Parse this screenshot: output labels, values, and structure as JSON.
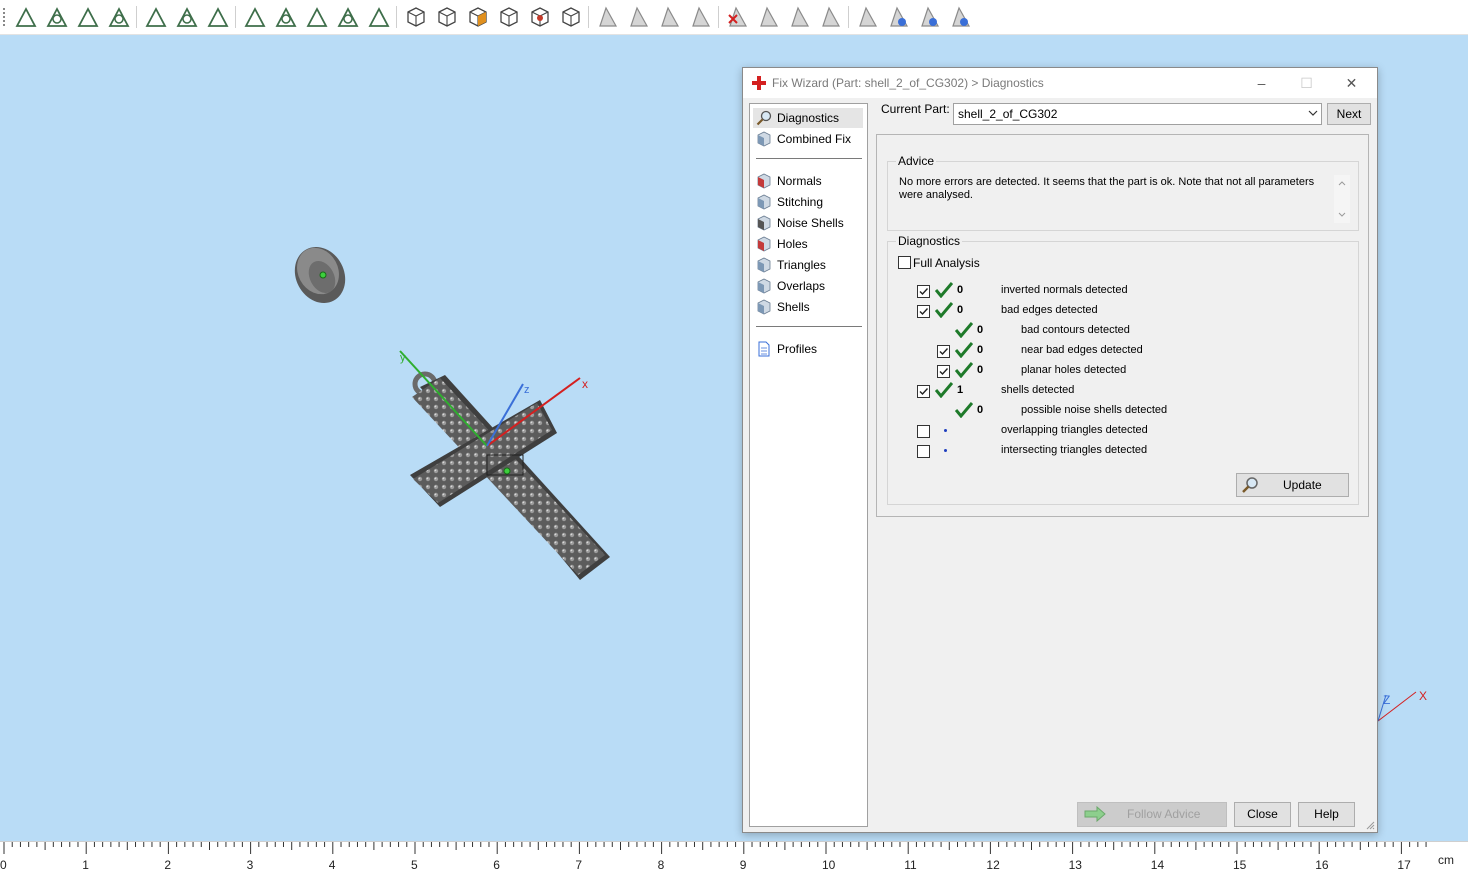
{
  "toolbar": {
    "groups": [
      [
        "arrow-select-icon",
        "face-select-icon",
        "surface-select-icon",
        "shell-select-icon"
      ],
      [
        "box-select-icon",
        "lasso-select-icon",
        "brush-select-icon"
      ],
      [
        "mesh-select-icon",
        "node-select-icon",
        "cut-select-icon",
        "wheel-select-icon",
        "sphere-select-icon"
      ],
      [
        "view-front-icon",
        "view-top-icon",
        "view-iso-icon",
        "view-wire-icon",
        "view-shaded-icon",
        "view-all-icon"
      ],
      [
        "triangle-mark-icon",
        "triangle-unmark-icon",
        "triangle-expand-icon",
        "triangle-shrink-icon"
      ],
      [
        "delete-triangles-icon",
        "invert-triangles-icon",
        "cut-triangles-icon",
        "split-triangles-icon"
      ],
      [
        "measure-icon",
        "measure-distance-icon",
        "measure-angle-icon",
        "measure-reset-icon"
      ]
    ]
  },
  "viewport": {
    "background": "#b9dcf6",
    "axis_labels": {
      "x": "x",
      "y": "y",
      "z": "z"
    },
    "corner_axis_labels": {
      "x": "X",
      "z": "Z"
    },
    "axis_colors": {
      "x": "#d42020",
      "y": "#2fae2f",
      "z": "#3a6fd8"
    }
  },
  "ruler": {
    "ticks": [
      "0",
      "1",
      "2",
      "3",
      "4",
      "5",
      "6",
      "7",
      "8",
      "9",
      "10",
      "11",
      "12",
      "13",
      "14",
      "15",
      "16",
      "17"
    ],
    "unit": "cm"
  },
  "dialog": {
    "title": "Fix Wizard (Part: shell_2_of_CG302) > Diagnostics",
    "title_icon": "red-cross-icon",
    "window_buttons": {
      "minimize": "–",
      "maximize": "☐",
      "close": "✕"
    },
    "nav": {
      "items": [
        {
          "label": "Diagnostics",
          "icon": "magnifier-icon",
          "selected": true
        },
        {
          "label": "Combined Fix",
          "icon": "combined-fix-icon"
        },
        {
          "label": "Normals",
          "icon": "normals-icon"
        },
        {
          "label": "Stitching",
          "icon": "stitching-icon"
        },
        {
          "label": "Noise Shells",
          "icon": "noise-shells-icon"
        },
        {
          "label": "Holes",
          "icon": "holes-icon"
        },
        {
          "label": "Triangles",
          "icon": "triangles-icon"
        },
        {
          "label": "Overlaps",
          "icon": "overlaps-icon"
        },
        {
          "label": "Shells",
          "icon": "shells-icon"
        },
        {
          "label": "Profiles",
          "icon": "profiles-icon"
        }
      ]
    },
    "current_part_label": "Current Part:",
    "current_part_value": "shell_2_of_CG302",
    "next_button": "Next",
    "advice": {
      "title": "Advice",
      "text": "No more errors are detected. It seems that the part is ok. Note that not all parameters were analysed."
    },
    "diagnostics": {
      "title": "Diagnostics",
      "full_analysis_label": "Full Analysis",
      "full_analysis_checked": false,
      "rows": [
        {
          "checkbox": true,
          "checked": true,
          "status": "ok",
          "count": "0",
          "label": "inverted normals detected",
          "indent": 0
        },
        {
          "checkbox": true,
          "checked": true,
          "status": "ok",
          "count": "0",
          "label": "bad edges detected",
          "indent": 0
        },
        {
          "checkbox": false,
          "checked": false,
          "status": "ok",
          "count": "0",
          "label": "bad contours detected",
          "indent": 1
        },
        {
          "checkbox": true,
          "checked": true,
          "status": "ok",
          "count": "0",
          "label": "near bad edges detected",
          "indent": 1
        },
        {
          "checkbox": true,
          "checked": true,
          "status": "ok",
          "count": "0",
          "label": "planar holes detected",
          "indent": 1
        },
        {
          "checkbox": true,
          "checked": true,
          "status": "ok",
          "count": "1",
          "label": "shells detected",
          "indent": 0
        },
        {
          "checkbox": false,
          "checked": false,
          "status": "ok",
          "count": "0",
          "label": "possible noise shells detected",
          "indent": 1
        },
        {
          "checkbox": true,
          "checked": false,
          "status": "pending",
          "count": "",
          "label": "overlapping triangles detected",
          "indent": 0
        },
        {
          "checkbox": true,
          "checked": false,
          "status": "pending",
          "count": "",
          "label": "intersecting triangles detected",
          "indent": 0
        }
      ],
      "update_button": "Update"
    },
    "footer": {
      "follow_advice": "Follow Advice",
      "close": "Close",
      "help": "Help"
    },
    "colors": {
      "tick": "#1e7a2a",
      "dot": "#1f3fbf"
    }
  }
}
